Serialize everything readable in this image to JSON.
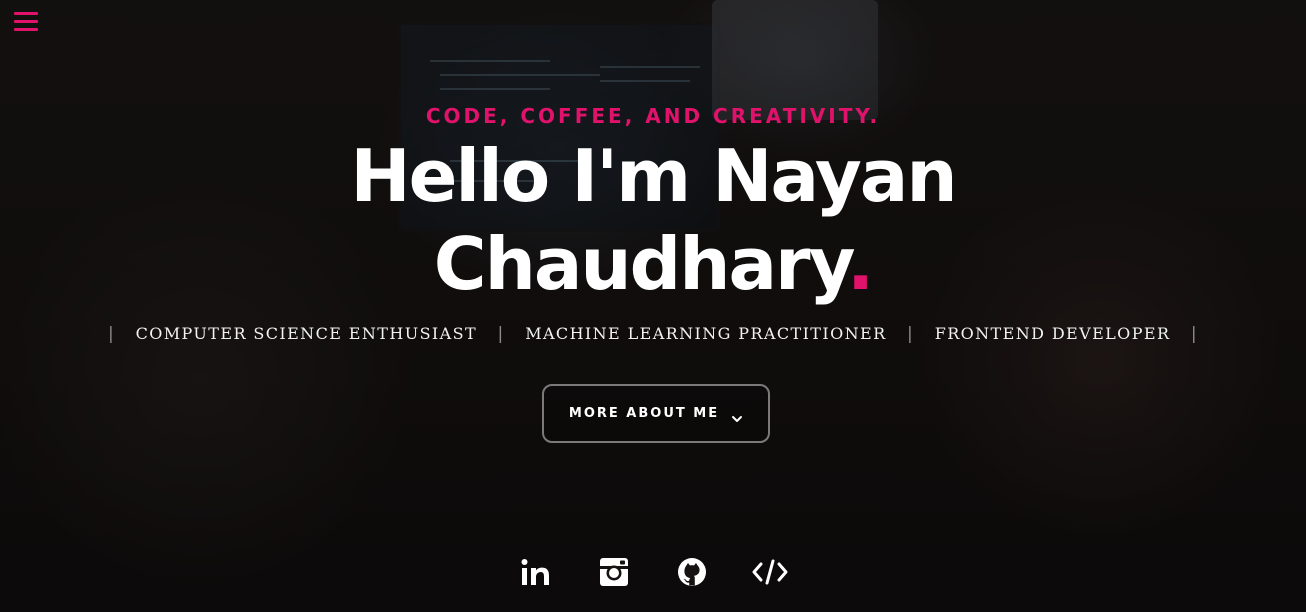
{
  "header": {
    "menu_icon": "hamburger-menu-icon",
    "accent_color": "#e0126b"
  },
  "hero": {
    "tagline": "CODE, COFFEE, AND CREATIVITY.",
    "headline_line1": "Hello I'm Nayan",
    "headline_line2": "Chaudhary",
    "headline_dot": ".",
    "roles": [
      "COMPUTER SCIENCE ENTHUSIAST",
      "MACHINE LEARNING PRACTITIONER",
      "FRONTEND DEVELOPER"
    ],
    "role_separator": "|",
    "cta_label": "MORE ABOUT ME",
    "cta_icon": "chevron-down-icon"
  },
  "socials": [
    {
      "name": "LinkedIn",
      "icon": "linkedin-icon"
    },
    {
      "name": "Instagram",
      "icon": "instagram-icon"
    },
    {
      "name": "GitHub",
      "icon": "github-icon"
    },
    {
      "name": "Code",
      "icon": "code-icon"
    }
  ]
}
